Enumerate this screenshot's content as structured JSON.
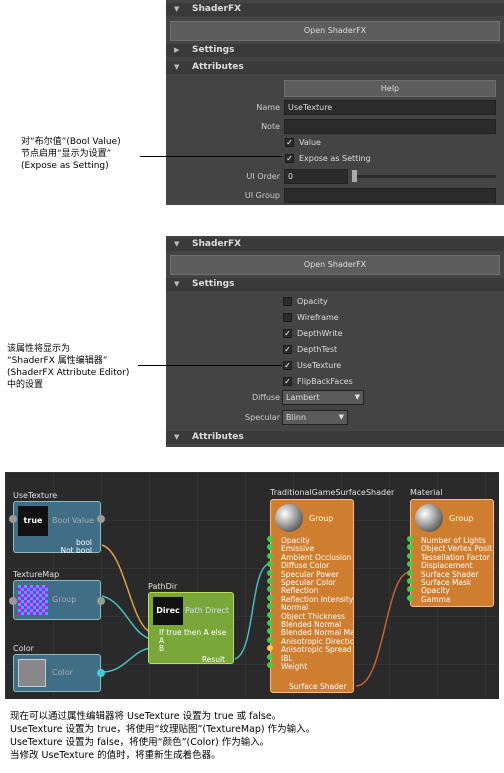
{
  "panel1": {
    "header": "ShaderFX",
    "open_btn": "Open ShaderFX",
    "settings": "Settings",
    "attributes": "Attributes",
    "help": "Help",
    "name_label": "Name",
    "name_value": "UseTexture",
    "note_label": "Note",
    "value_label": "Value",
    "expose_label": "Expose as Setting",
    "uiorder_label": "UI Order",
    "uiorder_value": "0",
    "uigroup_label": "UI Group"
  },
  "annot1": [
    "对“布尔值”(Bool Value)",
    "节点启用“显示为设置”",
    "(Expose as Setting)"
  ],
  "panel2": {
    "header": "ShaderFX",
    "open_btn": "Open ShaderFX",
    "settings": "Settings",
    "attributes": "Attributes",
    "checks": [
      {
        "label": "Opacity",
        "checked": false
      },
      {
        "label": "Wireframe",
        "checked": false
      },
      {
        "label": "DepthWrite",
        "checked": true
      },
      {
        "label": "DepthTest",
        "checked": true
      },
      {
        "label": "UseTexture",
        "checked": true
      },
      {
        "label": "FlipBackFaces",
        "checked": true
      }
    ],
    "diffuse_label": "Diffuse",
    "diffuse_value": "Lambert",
    "specular_label": "Specular",
    "specular_value": "Blinn"
  },
  "annot2": [
    "该属性将显示为",
    "“ShaderFX 属性编辑器”",
    "(ShaderFX Attribute Editor)",
    "中的设置"
  ],
  "graph": {
    "usetex": {
      "title": "UseTexture",
      "icon": "true",
      "label": "Bool Value",
      "out1": "bool",
      "out2": "Not bool"
    },
    "texmap": {
      "title": "TextureMap",
      "label": "Group"
    },
    "color": {
      "title": "Color",
      "label": "Color"
    },
    "pathdir": {
      "title": "PathDir",
      "icon": "Direc",
      "label": "Path Direct",
      "rows": [
        "If true then A else",
        "A",
        "B"
      ],
      "result": "Result"
    },
    "tgss": {
      "title": "TraditionalGameSurfaceShader",
      "label": "Group",
      "rows": [
        "Opacity",
        "Emissive",
        "Ambient Occlusion",
        "Diffuse Color",
        "Specular Power",
        "Specular Color",
        "Reflection",
        "Reflection Intensity",
        "Normal",
        "Object Thickness",
        "Blended Normal",
        "Blended Normal Ma",
        "Anisotropic Directic",
        "Anisotropic Spread",
        "IBL",
        "Weight"
      ],
      "out": "Surface Shader"
    },
    "material": {
      "title": "Material",
      "label": "Group",
      "rows": [
        "Number of Lights",
        "Object Vertex Posit",
        "Tessellation Factor",
        "Displacement",
        "Surface Shader",
        "Surface Mask",
        "Opacity",
        "Gamma"
      ]
    }
  },
  "footer": [
    "现在可以通过属性编辑器将 UseTexture 设置为 true 或 false。",
    "UseTexture 设置为 true，将使用“纹理贴图”(TextureMap) 作为输入。",
    "UseTexture 设置为 false，将使用“颜色”(Color) 作为输入。",
    "当修改 UseTexture 的值时，将重新生成着色器。"
  ]
}
